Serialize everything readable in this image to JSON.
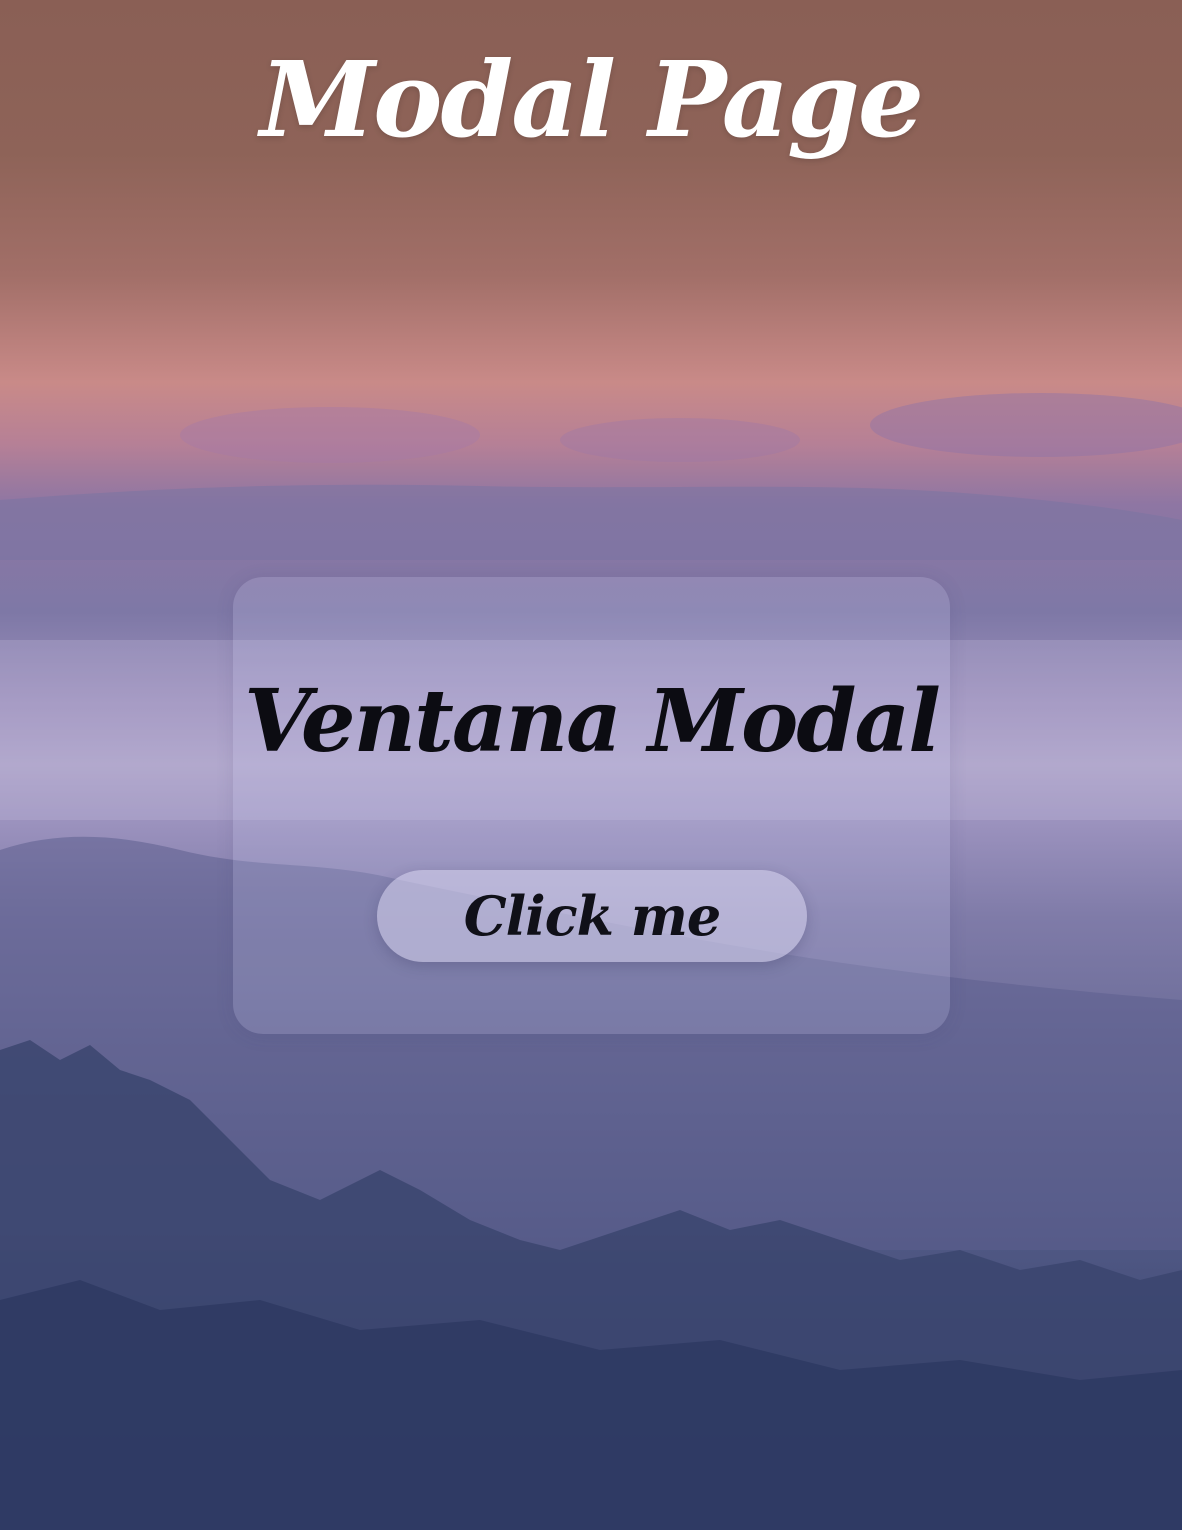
{
  "page": {
    "title": "Modal Page"
  },
  "modal": {
    "title": "Ventana Modal",
    "button_label": "Click me"
  },
  "colors": {
    "title_text": "#ffffff",
    "modal_text": "#0c0c12",
    "sky_top": "#8a5f55",
    "sky_pink": "#c98a88",
    "mist": "#aba1c7",
    "forest_dark": "#2f3a66"
  }
}
